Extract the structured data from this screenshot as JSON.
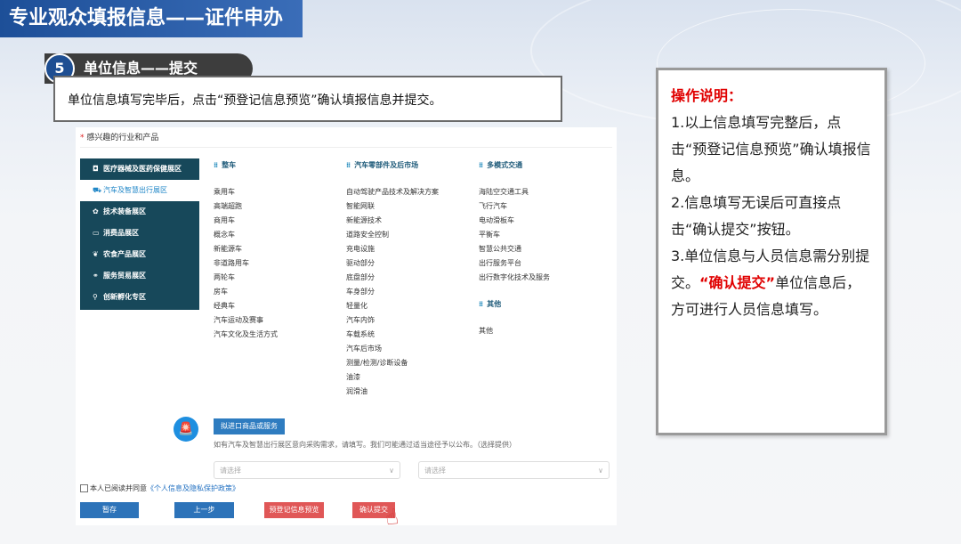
{
  "page_title": "专业观众填报信息——证件申办",
  "step": {
    "number": "5",
    "label": "单位信息——提交",
    "description": "单位信息填写完毕后，点击“预登记信息预览”确认填报信息并提交。"
  },
  "form": {
    "section_title": "感兴趣的行业和产品",
    "categories": [
      {
        "icon": "camera-icon",
        "glyph": "◘",
        "label": "医疗器械及医药保健展区"
      },
      {
        "icon": "car-icon",
        "glyph": "⛟",
        "label": "汽车及智慧出行展区"
      },
      {
        "icon": "gear-icon",
        "glyph": "✿",
        "label": "技术装备展区"
      },
      {
        "icon": "monitor-icon",
        "glyph": "▭",
        "label": "消费品展区"
      },
      {
        "icon": "leaf-icon",
        "glyph": "❦",
        "label": "农食产品展区"
      },
      {
        "icon": "handshake-icon",
        "glyph": "⚭",
        "label": "服务贸易展区"
      },
      {
        "icon": "location-pin-icon",
        "glyph": "⚲",
        "label": "创新孵化专区"
      }
    ],
    "col1": {
      "title": "整车",
      "items": [
        "乘用车",
        "高端超跑",
        "商用车",
        "概念车",
        "新能源车",
        "非道路用车",
        "两轮车",
        "房车",
        "经典车",
        "汽车运动及赛事",
        "汽车文化及生活方式"
      ]
    },
    "col2": {
      "title": "汽车零部件及后市场",
      "items": [
        "自动驾驶产品技术及解决方案",
        "智能网联",
        "新能源技术",
        "道路安全控制",
        "充电设施",
        "驱动部分",
        "底盘部分",
        "车身部分",
        "轻量化",
        "汽车内饰",
        "车载系统",
        "汽车后市场",
        "测量/检测/诊断设备",
        "油漆",
        "润滑油"
      ]
    },
    "col3": {
      "title": "多模式交通",
      "items": [
        "海陆空交通工具",
        "飞行汽车",
        "电动滑板车",
        "平衡车",
        "智慧公共交通",
        "出行服务平台",
        "出行数字化技术及服务"
      ]
    },
    "col4": {
      "title": "其他",
      "items": [
        "其他"
      ]
    },
    "import_button": "拟进口商品或服务",
    "import_note": "如有汽车及智慧出行展区意向采购需求，请填写。我们可能通过适当途径予以公布。（选择提供）",
    "select1_placeholder": "请选择",
    "select2_placeholder": "请选择",
    "agree_text": "本人已阅读并同意",
    "agree_link": "《个人信息及隐私保护政策》",
    "buttons": {
      "save": "暂存",
      "prev": "上一步",
      "preview": "预登记信息预览",
      "submit": "确认提交"
    }
  },
  "ops": {
    "title": "操作说明：",
    "line1": "1.以上信息填写完整后，点击“预登记信息预览”确认填报信息。",
    "line2": "2.信息填写无误后可直接点击“确认提交”按钮。",
    "line3_a": "3.单位信息与人员信息需分别提交。",
    "line3_red": "“确认提交”",
    "line3_b": "单位信息后，方可进行人员信息填写。"
  }
}
